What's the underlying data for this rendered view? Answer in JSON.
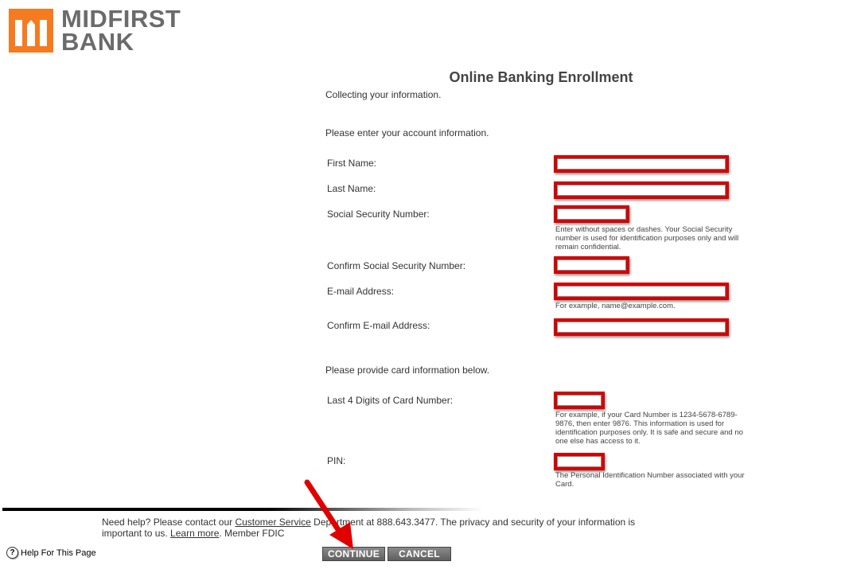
{
  "brand": {
    "line1": "MIDFIRST",
    "line2": "BANK",
    "logo_color": "#f47b20",
    "text_color": "#6b6b6b"
  },
  "page": {
    "title": "Online Banking Enrollment",
    "subtitle": "Collecting your information.",
    "account_intro": "Please enter your account information.",
    "card_intro": "Please provide card information below."
  },
  "form": {
    "first_name_label": "First Name:",
    "last_name_label": "Last Name:",
    "ssn_label": "Social Security Number:",
    "ssn_hint": "Enter without spaces or dashes. Your Social Security number is used for identification purposes only and will remain confidential.",
    "confirm_ssn_label": "Confirm Social Security Number:",
    "email_label": "E-mail Address:",
    "email_hint": "For example, name@example.com.",
    "confirm_email_label": "Confirm E-mail Address:",
    "card_last4_label": "Last 4 Digits of Card Number:",
    "card_last4_hint": "For example, if your Card Number is 1234-5678-6789-9876, then enter 9876. This information is used for identification purposes only. It is safe and secure and no one else has access to it.",
    "pin_label": "PIN:",
    "pin_hint": "The Personal Identification Number associated with your Card."
  },
  "footer": {
    "help_prefix": "Need help? Please contact our ",
    "customer_service_link": "Customer Service",
    "help_middle": " Department at 888.643.3477. The privacy and security of your information is important to us. ",
    "learn_more_link": "Learn more",
    "help_suffix": ". Member FDIC",
    "help_page_label": "Help For This Page"
  },
  "buttons": {
    "continue_label": "CONTINUE",
    "cancel_label": "CANCEL"
  },
  "colors": {
    "highlight_red": "#d60000",
    "button_gray": "#6f6f6f"
  },
  "icons": {
    "help": "question-circle-icon",
    "annotation": "red-arrow-icon"
  }
}
